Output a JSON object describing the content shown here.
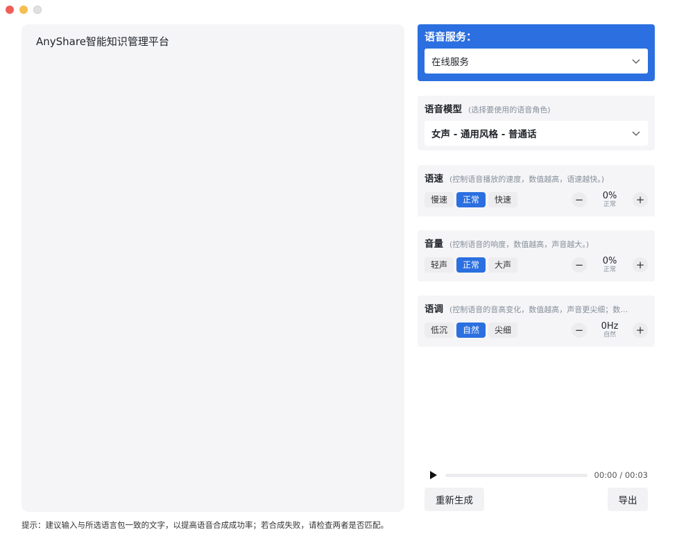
{
  "window": {
    "controls": [
      "close",
      "minimize",
      "zoom"
    ]
  },
  "editor": {
    "text": "AnyShare智能知识管理平台"
  },
  "hint": "提示：建议输入与所选语言包一致的文字，以提高语音合成成功率；若合成失败，请检查两者是否匹配。",
  "service": {
    "title": "语音服务：",
    "value": "在线服务",
    "icon": "chevron-down-icon",
    "accent": "#2b6fe0"
  },
  "model": {
    "title": "语音模型",
    "sub": "(选择要使用的语音角色)",
    "value": "女声 - 通用风格 - 普通话",
    "icon": "chevron-down-icon"
  },
  "speed": {
    "title": "语速",
    "sub": "(控制语音播放的速度，数值越高，语速越快。)",
    "options": [
      "慢速",
      "正常",
      "快速"
    ],
    "active": 1,
    "value": "0%",
    "value_label": "正常",
    "minus": "−",
    "plus": "+"
  },
  "volume": {
    "title": "音量",
    "sub": "(控制语音的响度，数值越高，声音越大。)",
    "options": [
      "轻声",
      "正常",
      "大声"
    ],
    "active": 1,
    "value": "0%",
    "value_label": "正常",
    "minus": "−",
    "plus": "+"
  },
  "pitch": {
    "title": "语调",
    "sub": "(控制语音的音高变化，数值越高，声音更尖细；数…",
    "options": [
      "低沉",
      "自然",
      "尖细"
    ],
    "active": 1,
    "value": "0Hz",
    "value_label": "自然",
    "minus": "−",
    "plus": "+"
  },
  "player": {
    "time": "00:00 / 00:03",
    "progress": 0,
    "icon": "play-icon"
  },
  "actions": {
    "regenerate": "重新生成",
    "export": "导出"
  }
}
